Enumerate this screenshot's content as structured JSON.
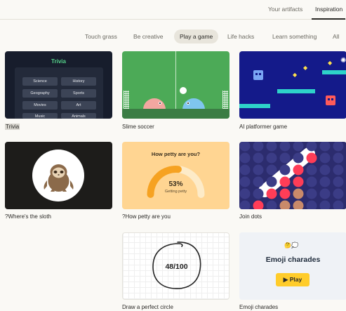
{
  "top_tabs": {
    "artifacts": "Your artifacts",
    "inspiration": "Inspiration"
  },
  "filters": [
    "Touch grass",
    "Be creative",
    "Play a game",
    "Life hacks",
    "Learn something",
    "All"
  ],
  "selected_filter": "Play a game",
  "cards": [
    {
      "label": "Trivia",
      "selected": true,
      "preview": {
        "title": "Trivia",
        "categories": [
          "Science",
          "History",
          "Geography",
          "Sports",
          "Movies",
          "Art",
          "Music",
          "Animals"
        ]
      }
    },
    {
      "label": "Slime soccer",
      "preview": {}
    },
    {
      "label": "AI platformer game",
      "preview": {}
    },
    {
      "label": "?Where's the sloth",
      "preview": {}
    },
    {
      "label": "?How petty are you",
      "preview": {
        "question": "How petty are you?",
        "percent": "53%",
        "status": "Getting petty",
        "gauge_fraction": 0.53
      }
    },
    {
      "label": "Join dots",
      "preview": {}
    },
    {
      "label": "Draw a perfect circle",
      "preview": {
        "score": "48/100"
      }
    },
    {
      "label": "Emoji charades",
      "preview": {
        "emoji": "🤔💭",
        "title": "Emoji charades",
        "button": "Play",
        "button_icon": "play-icon"
      }
    }
  ],
  "colors": {
    "background": "#faf9f5",
    "trivia_bg": "#171d2c",
    "trivia_accent": "#55d38a",
    "soccer_bg": "#4caa57",
    "platformer_bg": "#141a8a",
    "petty_bg": "#ffd592",
    "petty_arc": "#f6a221",
    "dots_bg": "#2c2c6e",
    "dots_red": "#ff3d57",
    "charades_button": "#ffcc2a"
  }
}
